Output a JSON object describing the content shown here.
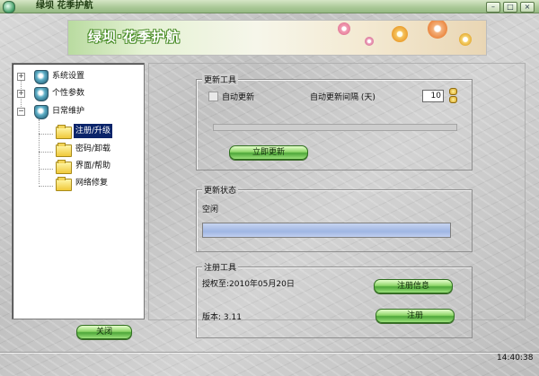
{
  "window": {
    "title": "绿坝 花季护航",
    "controls": {
      "minimize": "–",
      "maximize": "□",
      "close": "×"
    }
  },
  "banner": {
    "title": "绿坝·花季护航"
  },
  "tree": {
    "items": [
      {
        "label": "系统设置",
        "expander": "+",
        "icon": "shield-icon"
      },
      {
        "label": "个性参数",
        "expander": "+",
        "icon": "shield-icon"
      },
      {
        "label": "日常维护",
        "expander": "−",
        "icon": "shield-icon"
      },
      {
        "label": "注册/升级",
        "icon": "folder-icon",
        "selected": true
      },
      {
        "label": "密码/卸载",
        "icon": "folder-icon"
      },
      {
        "label": "界面/帮助",
        "icon": "folder-icon"
      },
      {
        "label": "网络修复",
        "icon": "folder-icon"
      }
    ]
  },
  "close_button": {
    "label": "关闭"
  },
  "update_tools": {
    "title": "更新工具",
    "auto_update_label": "自动更新",
    "auto_update_checked": false,
    "interval_label": "自动更新间隔 (天)",
    "interval_value": "10",
    "update_now_label": "立即更新"
  },
  "update_status": {
    "title": "更新状态",
    "status_text": "空闲"
  },
  "registration": {
    "title": "注册工具",
    "license_text": "授权至:2010年05月20日",
    "version_text": "版本: 3.11",
    "info_button_label": "注册信息",
    "register_button_label": "注册"
  },
  "status_bar": {
    "time": "14:40:38"
  }
}
